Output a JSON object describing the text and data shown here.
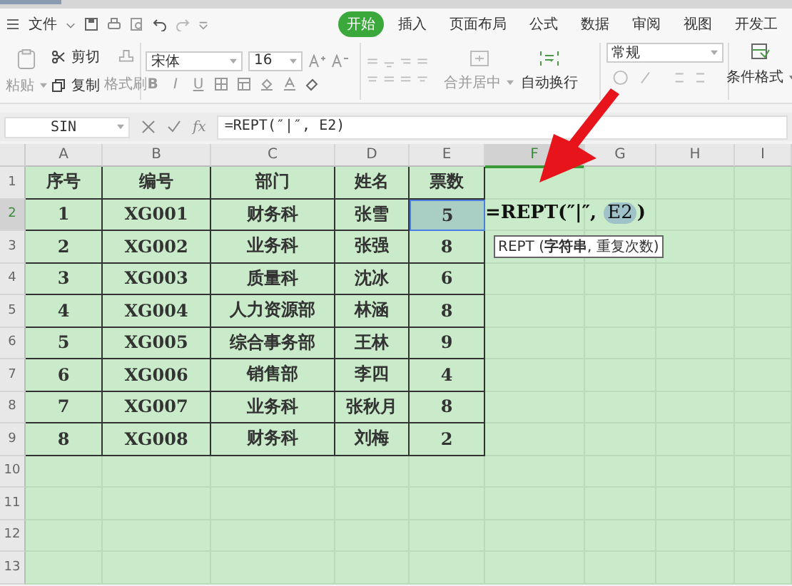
{
  "quick_bar": {
    "menu_label": "文件"
  },
  "ribbon_tabs": [
    {
      "label": "开始",
      "selected": true
    },
    {
      "label": "插入",
      "selected": false
    },
    {
      "label": "页面布局",
      "selected": false
    },
    {
      "label": "公式",
      "selected": false
    },
    {
      "label": "数据",
      "selected": false
    },
    {
      "label": "审阅",
      "selected": false
    },
    {
      "label": "视图",
      "selected": false
    },
    {
      "label": "开发工",
      "selected": false
    }
  ],
  "ribbon": {
    "paste": "粘贴",
    "cut": "剪切",
    "copy": "复制",
    "format_painter": "格式刷",
    "font_name": "宋体",
    "font_size": "16",
    "bold": "B",
    "italic": "I",
    "underline": "U",
    "merge": "合并居中",
    "wrap": "自动换行",
    "number_format": "常规",
    "conditional": "条件格式"
  },
  "formula_bar": {
    "name_box": "SIN",
    "fx": "fx",
    "formula": "=REPT(″|″, E2)"
  },
  "sheet": {
    "columns": [
      {
        "label": "A",
        "selected": false
      },
      {
        "label": "B",
        "selected": false
      },
      {
        "label": "C",
        "selected": false
      },
      {
        "label": "D",
        "selected": false
      },
      {
        "label": "E",
        "selected": false
      },
      {
        "label": "F",
        "selected": true
      },
      {
        "label": "G",
        "selected": false
      },
      {
        "label": "H",
        "selected": false
      },
      {
        "label": "I",
        "selected": false
      }
    ],
    "rows": [
      {
        "number": "1",
        "selected": false,
        "cells": [
          {
            "text": "序号",
            "selected": false
          },
          {
            "text": "编号",
            "selected": false
          },
          {
            "text": "部门",
            "selected": false
          },
          {
            "text": "姓名",
            "selected": false
          },
          {
            "text": "票数",
            "selected": false
          }
        ]
      },
      {
        "number": "2",
        "selected": true,
        "cells": [
          {
            "text": "1",
            "selected": false
          },
          {
            "text": "XG001",
            "selected": false
          },
          {
            "text": "财务科",
            "selected": false
          },
          {
            "text": "张雪",
            "selected": false
          },
          {
            "text": "5",
            "selected": true
          }
        ],
        "editor": {
          "before": "=REPT(″|″, ",
          "ref": "E2",
          "after": ")",
          "tooltip": "REPT (**字符串**, 重复次数)"
        }
      },
      {
        "number": "3",
        "selected": false,
        "cells": [
          {
            "text": "2",
            "selected": false
          },
          {
            "text": "XG002",
            "selected": false
          },
          {
            "text": "业务科",
            "selected": false
          },
          {
            "text": "张强",
            "selected": false
          },
          {
            "text": "8",
            "selected": false
          }
        ]
      },
      {
        "number": "4",
        "selected": false,
        "cells": [
          {
            "text": "3",
            "selected": false
          },
          {
            "text": "XG003",
            "selected": false
          },
          {
            "text": "质量科",
            "selected": false
          },
          {
            "text": "沈冰",
            "selected": false
          },
          {
            "text": "6",
            "selected": false
          }
        ]
      },
      {
        "number": "5",
        "selected": false,
        "cells": [
          {
            "text": "4",
            "selected": false
          },
          {
            "text": "XG004",
            "selected": false
          },
          {
            "text": "人力资源部",
            "selected": false
          },
          {
            "text": "林涵",
            "selected": false
          },
          {
            "text": "8",
            "selected": false
          }
        ]
      },
      {
        "number": "6",
        "selected": false,
        "cells": [
          {
            "text": "5",
            "selected": false
          },
          {
            "text": "XG005",
            "selected": false
          },
          {
            "text": "综合事务部",
            "selected": false
          },
          {
            "text": "王林",
            "selected": false
          },
          {
            "text": "9",
            "selected": false
          }
        ]
      },
      {
        "number": "7",
        "selected": false,
        "cells": [
          {
            "text": "6",
            "selected": false
          },
          {
            "text": "XG006",
            "selected": false
          },
          {
            "text": "销售部",
            "selected": false
          },
          {
            "text": "李四",
            "selected": false
          },
          {
            "text": "4",
            "selected": false
          }
        ]
      },
      {
        "number": "8",
        "selected": false,
        "cells": [
          {
            "text": "7",
            "selected": false
          },
          {
            "text": "XG007",
            "selected": false
          },
          {
            "text": "业务科",
            "selected": false
          },
          {
            "text": "张秋月",
            "selected": false
          },
          {
            "text": "8",
            "selected": false
          }
        ]
      },
      {
        "number": "9",
        "selected": false,
        "cells": [
          {
            "text": "8",
            "selected": false
          },
          {
            "text": "XG008",
            "selected": false
          },
          {
            "text": "财务科",
            "selected": false
          },
          {
            "text": "刘梅",
            "selected": false
          },
          {
            "text": "2",
            "selected": false
          }
        ]
      },
      {
        "number": "10",
        "selected": false
      },
      {
        "number": "11",
        "selected": false
      },
      {
        "number": "12",
        "selected": false
      },
      {
        "number": "13",
        "selected": false
      }
    ]
  }
}
